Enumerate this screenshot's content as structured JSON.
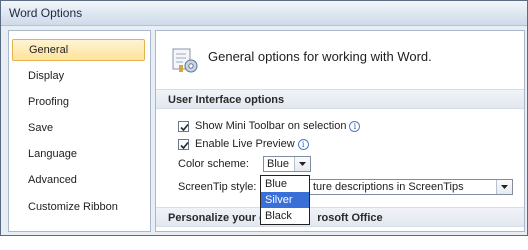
{
  "window": {
    "title": "Word Options"
  },
  "sidebar": {
    "items": [
      {
        "label": "General",
        "active": true
      },
      {
        "label": "Display"
      },
      {
        "label": "Proofing"
      },
      {
        "label": "Save"
      },
      {
        "label": "Language"
      },
      {
        "label": "Advanced"
      },
      {
        "label": "Customize Ribbon"
      }
    ]
  },
  "main": {
    "header_text": "General options for working with Word.",
    "header_icon": "options-gear-icon",
    "sections": {
      "ui_options": {
        "title": "User Interface options",
        "show_mini_toolbar": {
          "label": "Show Mini Toolbar on selection",
          "checked": true
        },
        "enable_live_preview": {
          "label": "Enable Live Preview",
          "checked": true
        },
        "color_scheme": {
          "label": "Color scheme:",
          "value": "Blue",
          "options": [
            "Blue",
            "Silver",
            "Black"
          ],
          "highlighted": "Silver"
        },
        "screentip_style": {
          "label": "ScreenTip style:",
          "value": "ture descriptions in ScreenTips"
        }
      },
      "personalize": {
        "title_left": "Personalize your c",
        "title_right": "rosoft Office"
      }
    }
  },
  "colors": {
    "accent": "#3a6fd8",
    "active_nav": "#ffe39b"
  }
}
